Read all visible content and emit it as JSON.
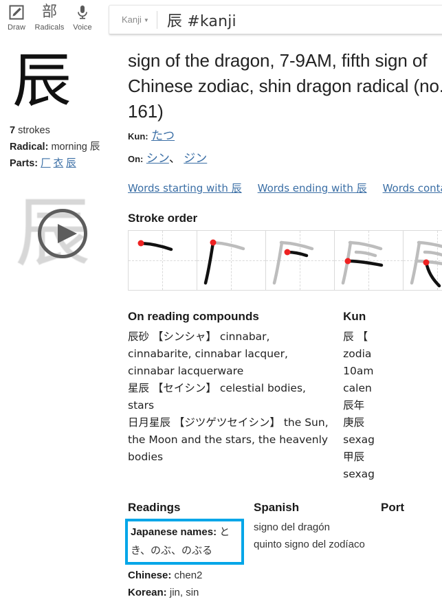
{
  "toolbar": {
    "items": [
      {
        "icon": "draw-pencil-icon",
        "label": "Draw"
      },
      {
        "icon": "radicals-icon",
        "glyph": "部",
        "label": "Radicals"
      },
      {
        "icon": "microphone-icon",
        "label": "Voice"
      }
    ]
  },
  "search": {
    "type_label": "Kanji",
    "caret": "▼",
    "query": "辰 #kanji"
  },
  "kanji": {
    "character": "辰",
    "strokes_count": "7",
    "strokes_label": "strokes",
    "radical_label": "Radical:",
    "radical_meaning": "morning",
    "radical_char": "辰",
    "parts_label": "Parts:",
    "parts": [
      "厂",
      "衣",
      "辰"
    ]
  },
  "main": {
    "definition": "sign of the dragon, 7-9AM, fifth sign of Chinese zodiac, shin dragon radical (no. 161)",
    "kun_label": "Kun:",
    "kun_readings": [
      "たつ"
    ],
    "on_label": "On:",
    "on_readings": [
      "シン",
      "ジン"
    ],
    "on_separator": "、",
    "word_links": [
      "Words starting with 辰",
      "Words ending with 辰",
      "Words contain"
    ]
  },
  "stroke_order": {
    "title": "Stroke order",
    "cells": 5
  },
  "on_compounds": {
    "title": "On reading compounds",
    "entries": [
      "辰砂 【シンシャ】 cinnabar, cinnabarite, cinnabar lacquer, cinnabar lacquerware",
      "星辰 【セイシン】 celestial bodies, stars",
      "日月星辰 【ジツゲツセイシン】 the Sun, the Moon and the stars, the heavenly bodies"
    ]
  },
  "kun_compounds": {
    "title": "Kun",
    "entries": [
      "辰 【",
      "zodia",
      "10am",
      "calen",
      "辰年",
      "庚辰",
      "sexag",
      "甲辰",
      "sexag"
    ]
  },
  "readings": {
    "title": "Readings",
    "japanese_names_label": "Japanese names:",
    "japanese_names_value": "とき、のぶ、のぶる",
    "chinese_label": "Chinese:",
    "chinese_value": "chen2",
    "korean_label": "Korean:",
    "korean_value": "jin, sin"
  },
  "spanish": {
    "title": "Spanish",
    "entries": [
      "signo del dragón",
      "quinto signo del zodíaco"
    ]
  },
  "portuguese": {
    "title": "Port"
  },
  "colors": {
    "link": "#3a6ea5",
    "highlight_box": "#00a6e8",
    "stroke_dot": "#ee2222",
    "stroke_done": "#111111",
    "stroke_ghost": "#bdbdbd"
  }
}
